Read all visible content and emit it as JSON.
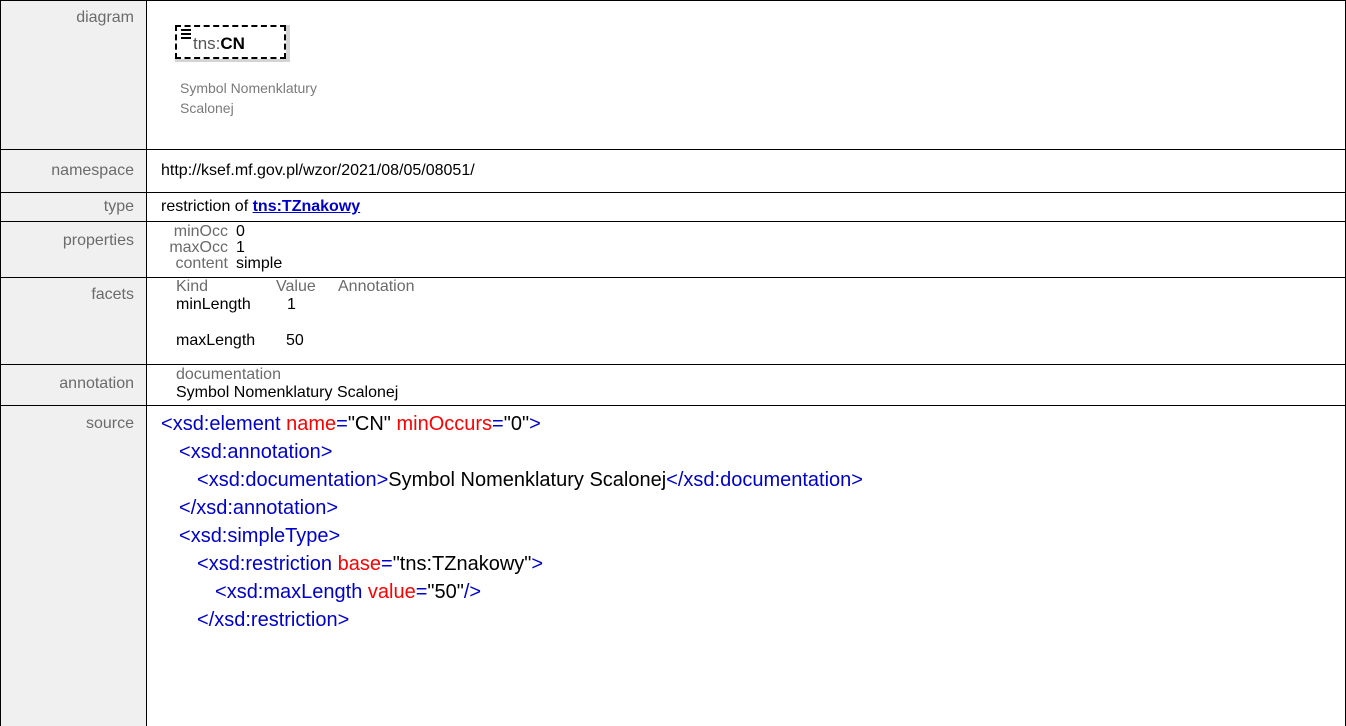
{
  "diagram": {
    "label": "diagram",
    "element_prefix": "tns:",
    "element_name": "CN",
    "caption_line1": "Symbol Nomenklatury",
    "caption_line2": "Scalonej"
  },
  "namespace": {
    "label": "namespace",
    "value": "http://ksef.mf.gov.pl/wzor/2021/08/05/08051/"
  },
  "type": {
    "label": "type",
    "prefix": "restriction of ",
    "link": "tns:TZnakowy"
  },
  "properties": {
    "label": "properties",
    "items": [
      {
        "key": "minOcc",
        "value": "0"
      },
      {
        "key": "maxOcc",
        "value": "1"
      },
      {
        "key": "content",
        "value": "simple"
      }
    ]
  },
  "facets": {
    "label": "facets",
    "headers": [
      "Kind",
      "Value",
      "Annotation"
    ],
    "rows": [
      {
        "kind": "minLength",
        "value": "1"
      },
      {
        "kind": "maxLength",
        "value": "50"
      }
    ]
  },
  "annotation": {
    "label": "annotation",
    "sub_label": "documentation",
    "text": "Symbol Nomenklatury Scalonej"
  },
  "source": {
    "label": "source",
    "l1_open": "<",
    "l1_tag": "xsd:element",
    "l1_attr1": "name",
    "l1_val1": "\"CN\"",
    "l1_attr2": "minOccurs",
    "l1_val2": "\"0\"",
    "l2_tag": "xsd:annotation",
    "l3_tag": "xsd:documentation",
    "l3_text": "Symbol Nomenklatury Scalonej",
    "l3_close": "/xsd:documentation",
    "l4_close": "/xsd:annotation",
    "l5_tag": "xsd:simpleType",
    "l6_tag": "xsd:restriction",
    "l6_attr": "base",
    "l6_val": "\"tns:TZnakowy\"",
    "l7_tag": "xsd:maxLength",
    "l7_attr": "value",
    "l7_val": "\"50\"",
    "l8_close": "/xsd:restriction"
  },
  "colors": {
    "tag": "#0000cc",
    "bracket": "#880000",
    "attribute": "#ff0000",
    "label_bg": "#f0f0f0"
  }
}
